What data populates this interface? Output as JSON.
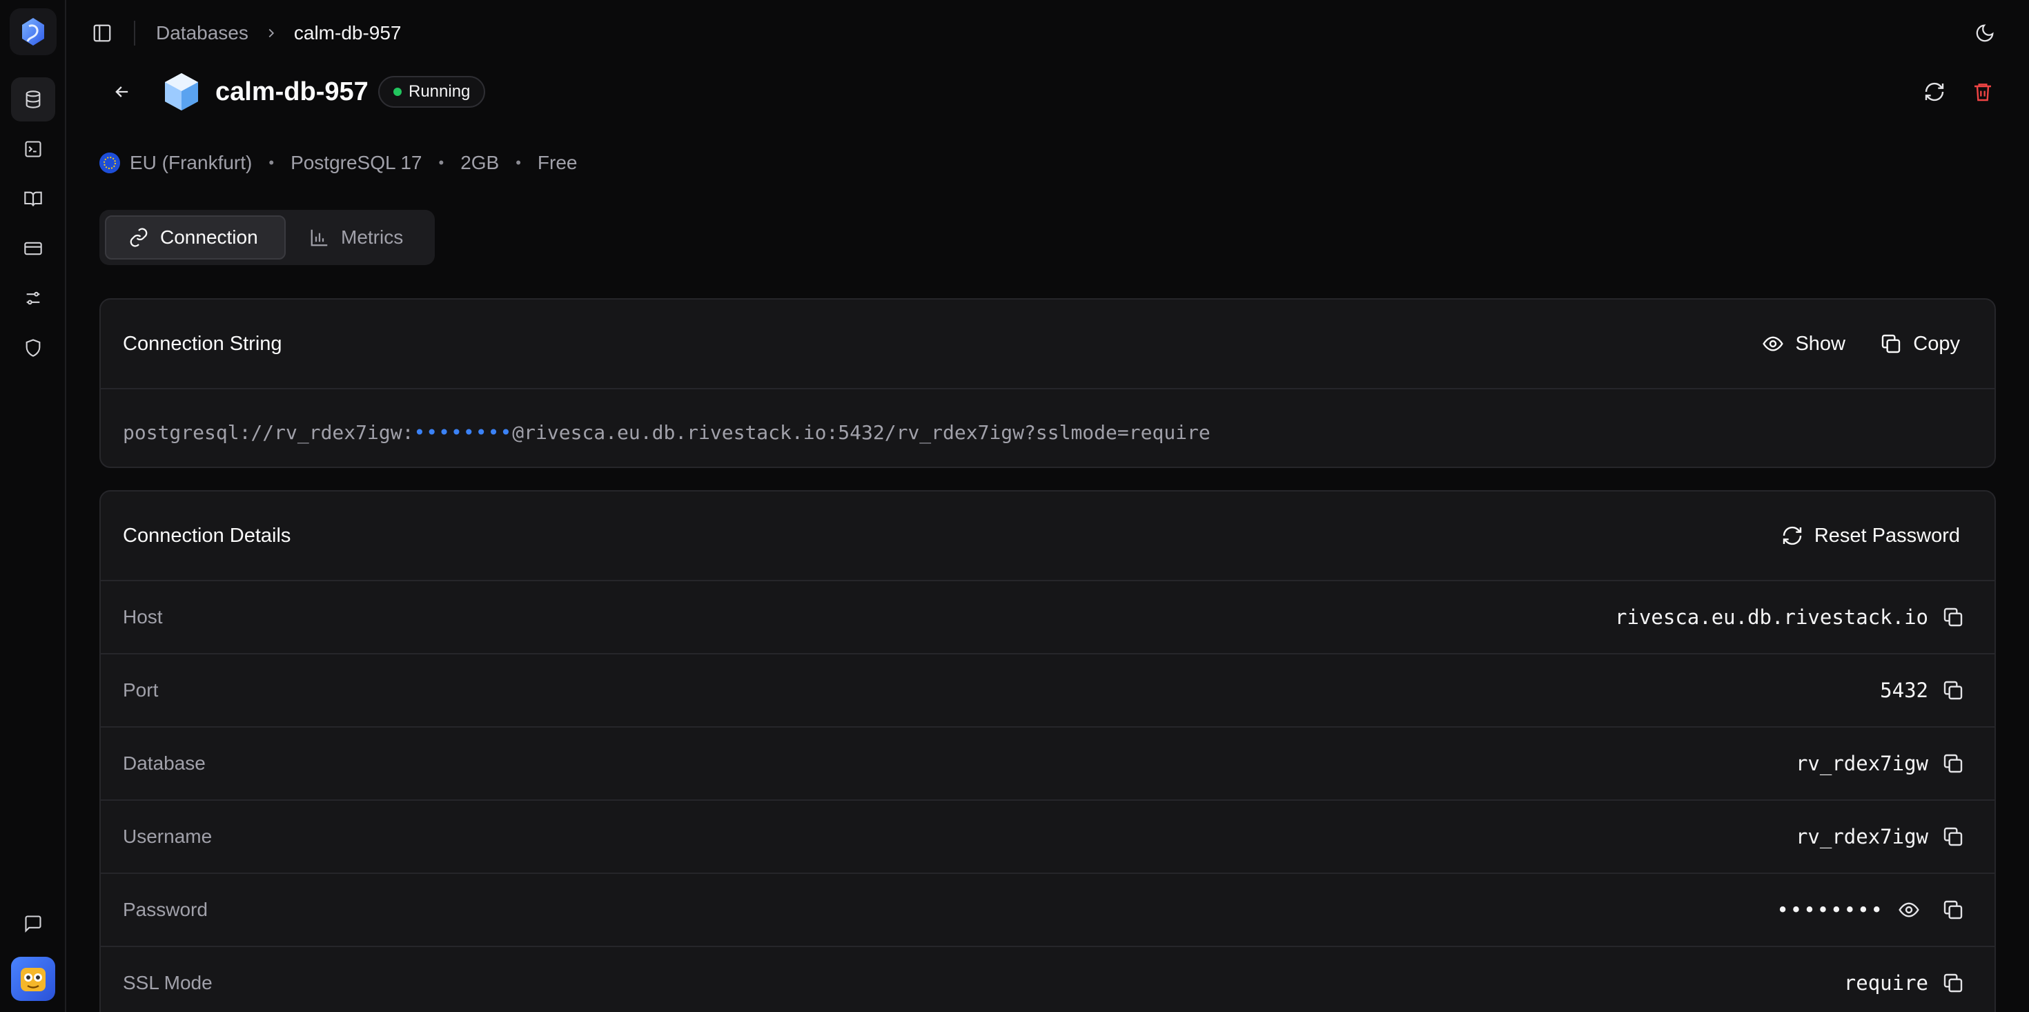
{
  "rail": {
    "items": [
      {
        "icon": "database-icon",
        "active": true
      },
      {
        "icon": "terminal-icon",
        "active": false
      },
      {
        "icon": "book-icon",
        "active": false
      },
      {
        "icon": "credit-card-icon",
        "active": false
      },
      {
        "icon": "settings-sliders-icon",
        "active": false
      },
      {
        "icon": "shield-icon",
        "active": false
      }
    ],
    "bottom": [
      {
        "icon": "chat-icon"
      },
      {
        "icon": "user-avatar"
      }
    ]
  },
  "breadcrumb": {
    "parent": "Databases",
    "current": "calm-db-957"
  },
  "database": {
    "name": "calm-db-957",
    "status": "Running",
    "status_color": "#22c55e",
    "region": "EU (Frankfurt)",
    "engine": "PostgreSQL 17",
    "size": "2GB",
    "plan": "Free"
  },
  "tabs": [
    {
      "label": "Connection",
      "icon": "link-icon",
      "active": true
    },
    {
      "label": "Metrics",
      "icon": "bar-chart-icon",
      "active": false
    }
  ],
  "connection_string": {
    "title": "Connection String",
    "show_label": "Show",
    "copy_label": "Copy",
    "prefix": "postgresql://rv_rdex7igw:",
    "masked": "••••••••",
    "suffix": "@rivesca.eu.db.rivestack.io:5432/rv_rdex7igw?sslmode=require"
  },
  "connection_details": {
    "title": "Connection Details",
    "reset_label": "Reset Password",
    "rows": [
      {
        "label": "Host",
        "value": "rivesca.eu.db.rivestack.io"
      },
      {
        "label": "Port",
        "value": "5432"
      },
      {
        "label": "Database",
        "value": "rv_rdex7igw"
      },
      {
        "label": "Username",
        "value": "rv_rdex7igw"
      },
      {
        "label": "Password",
        "value": "••••••••"
      },
      {
        "label": "SSL Mode",
        "value": "require"
      }
    ]
  },
  "colors": {
    "background": "#0a0a0b",
    "card": "#161618",
    "accent_blue": "#3b82f6",
    "danger": "#ef4444"
  }
}
